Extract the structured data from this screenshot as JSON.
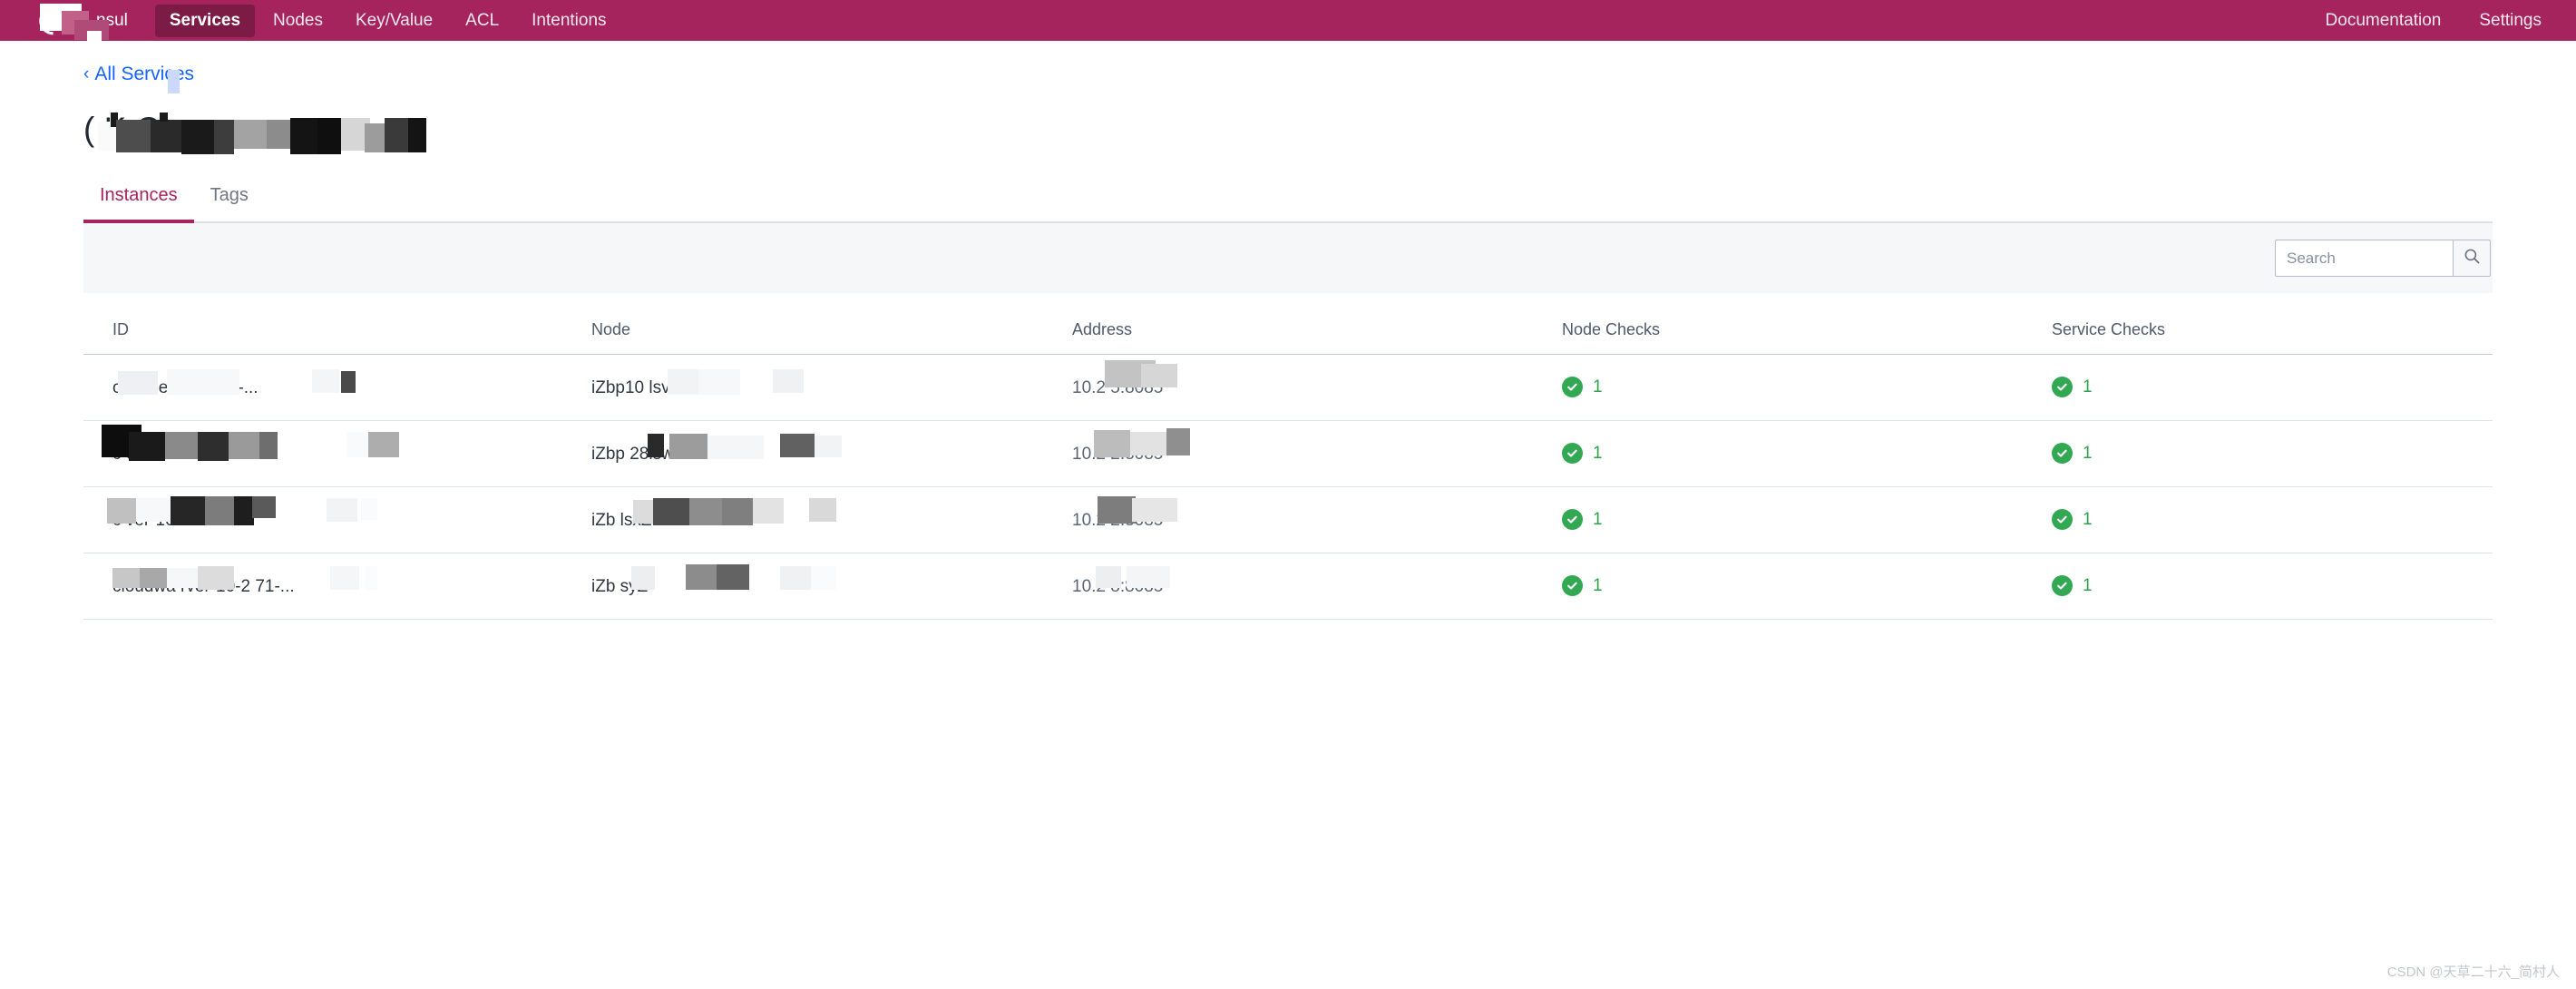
{
  "navbar": {
    "logo_icon": "consul-logo-icon",
    "datacenter_label": "nsul",
    "items": [
      {
        "label": "Services",
        "active": true
      },
      {
        "label": "Nodes",
        "active": false
      },
      {
        "label": "Key/Value",
        "active": false
      },
      {
        "label": "ACL",
        "active": false
      },
      {
        "label": "Intentions",
        "active": false
      }
    ],
    "right_items": [
      {
        "label": "Documentation"
      },
      {
        "label": "Settings"
      }
    ],
    "background_color": "#a6245e",
    "active_item_color": "#7b1b46"
  },
  "breadcrumb": {
    "chevron": "‹",
    "label": "All Services",
    "color": "#1563ff"
  },
  "page": {
    "title": "(                  K  C  ver"
  },
  "tabs": [
    {
      "label": "Instances",
      "active": true
    },
    {
      "label": "Tags",
      "active": false
    }
  ],
  "search": {
    "placeholder": "Search",
    "value": "",
    "button_icon": "search-icon"
  },
  "table": {
    "columns": [
      "ID",
      "Node",
      "Address",
      "Node Checks",
      "Service Checks"
    ],
    "rows": [
      {
        "id": "cloud      er-10-2   71-...",
        "node": "iZbp10        lsvZ",
        "address": "10.2        5:8085",
        "node_checks": "1",
        "service_checks": "1",
        "status_icon": "check-circle-icon"
      },
      {
        "id": "c            er-10-22   7-...",
        "node": "iZbp            28lswZ",
        "address": "10.2      2:8085",
        "node_checks": "1",
        "service_checks": "1",
        "status_icon": "check-circle-icon"
      },
      {
        "id": "c          ver-10-2   9-...",
        "node": "iZb           lsxZ",
        "address": "10.2       2:8085",
        "node_checks": "1",
        "service_checks": "1",
        "status_icon": "check-circle-icon"
      },
      {
        "id": "cloudwa     rver-10-2   71-...",
        "node": "iZb           syZ",
        "address": "10.2      8:8085",
        "node_checks": "1",
        "service_checks": "1",
        "status_icon": "check-circle-icon"
      }
    ]
  },
  "watermark": {
    "text": "CSDN @天草二十六_简村人"
  }
}
